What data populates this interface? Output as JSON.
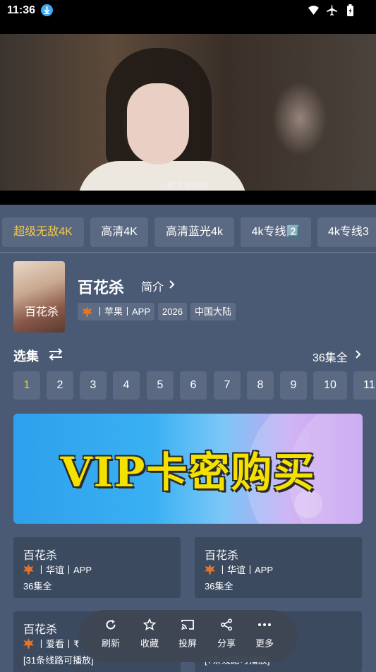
{
  "status_bar": {
    "time": "11:36"
  },
  "video": {
    "subtitle": "郡主有吩咐"
  },
  "sources": [
    {
      "label": "超级无敌4K",
      "active": true
    },
    {
      "label": "高清4K"
    },
    {
      "label": "高清蓝光4k"
    },
    {
      "label": "4k专线2️⃣"
    },
    {
      "label": "4k专线3"
    }
  ],
  "show": {
    "poster_text": "百花杀",
    "title": "百花杀",
    "intro_label": "简介",
    "source_chip": "丨苹果丨APP",
    "year": "2026",
    "region": "中国大陆"
  },
  "episodes": {
    "header": "选集",
    "total": "36集全",
    "items": [
      "1",
      "2",
      "3",
      "4",
      "5",
      "6",
      "7",
      "8",
      "9",
      "10",
      "11"
    ],
    "active_index": 0
  },
  "banner": {
    "text": "VIP卡密购买"
  },
  "related": [
    {
      "title": "百花杀",
      "meta": "丨华谊丨APP",
      "sub": "36集全"
    },
    {
      "title": "百花杀",
      "meta": "丨华谊丨APP",
      "sub": "36集全"
    },
    {
      "title": "百花杀",
      "meta": "丨爱看丨₹",
      "sub": "[31条线路可播放]"
    },
    {
      "title": "",
      "meta": "",
      "sub": "[7条线路可播放]"
    }
  ],
  "float_bar": {
    "refresh": "刷新",
    "favorite": "收藏",
    "cast": "投屏",
    "share": "分享",
    "more": "更多"
  },
  "colors": {
    "accent": "#f2c94c",
    "background": "#4a5a74",
    "card": "#3c4a60"
  }
}
